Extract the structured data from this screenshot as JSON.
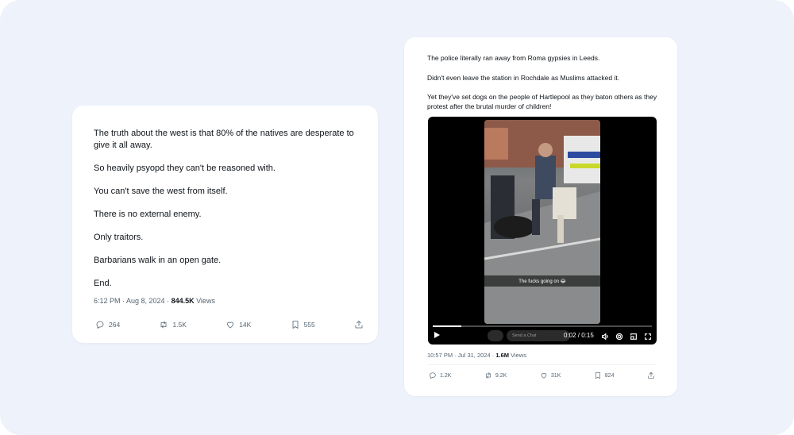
{
  "left_post": {
    "lines": [
      "The truth about the west is that 80% of the natives are desperate to give it all away.",
      "So heavily psyopd they can't be reasoned with.",
      "You can't save the west from itself.",
      "There is no external enemy.",
      "Only traitors.",
      "Barbarians walk in an open gate.",
      "End."
    ],
    "timestamp": "6:12 PM · Aug 8, 2024 · ",
    "views_count": "844.5K",
    "views_label": " Views",
    "actions": {
      "replies": "264",
      "reposts": "1.5K",
      "likes": "14K",
      "bookmarks": "555"
    }
  },
  "right_post": {
    "lines": [
      "The police literally ran away from Roma gypsies in Leeds.",
      "Didn't even leave the station in Rochdale as Muslims attacked it.",
      "Yet they've set dogs on the people of Hartlepool as they baton others as they protest after the brutal murder of children!"
    ],
    "video": {
      "caption": "The fucks going on 😂",
      "chat_placeholder": "Send a Chat",
      "time": "0:02 / 0:15",
      "progress": 0.13
    },
    "timestamp": "10:57 PM · Jul 31, 2024 · ",
    "views_count": "1.6M",
    "views_label": " Views",
    "actions": {
      "replies": "1.2K",
      "reposts": "9.2K",
      "likes": "31K",
      "bookmarks": "824"
    }
  },
  "icons": {
    "reply": "reply-icon",
    "repost": "repost-icon",
    "like": "heart-icon",
    "bookmark": "bookmark-icon",
    "share": "share-icon"
  },
  "colors": {
    "background": "#eef2fb",
    "card": "#ffffff",
    "text": "#0f1419",
    "muted": "#536471"
  }
}
